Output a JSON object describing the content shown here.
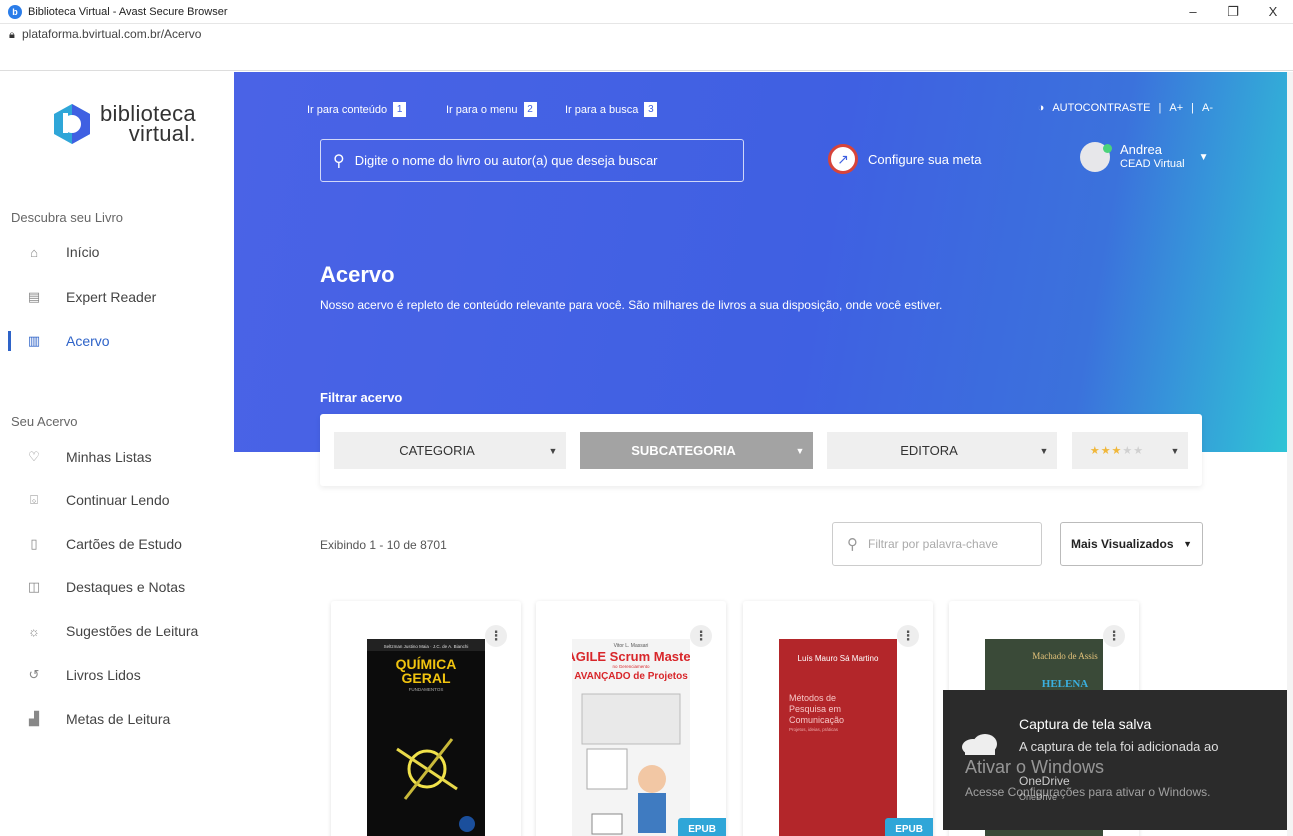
{
  "browser": {
    "window_title": "Biblioteca Virtual - Avast Secure Browser",
    "url": "plataforma.bvirtual.com.br/Acervo",
    "controls": {
      "minimize": "–",
      "restore": "❐",
      "close": "X"
    }
  },
  "logo": {
    "line1": "biblioteca",
    "line2": "virtual."
  },
  "sidebar": {
    "section1": "Descubra seu Livro",
    "items1": [
      {
        "label": "Início",
        "icon": "home-icon"
      },
      {
        "label": "Expert Reader",
        "icon": "reader-icon"
      },
      {
        "label": "Acervo",
        "icon": "books-icon",
        "active": true
      }
    ],
    "section2": "Seu Acervo",
    "items2": [
      {
        "label": "Minhas Listas",
        "icon": "heart-icon"
      },
      {
        "label": "Continuar Lendo",
        "icon": "bookmark-icon"
      },
      {
        "label": "Cartões de Estudo",
        "icon": "cards-icon"
      },
      {
        "label": "Destaques e Notas",
        "icon": "note-icon"
      },
      {
        "label": "Sugestões de Leitura",
        "icon": "bulb-icon"
      },
      {
        "label": "Livros Lidos",
        "icon": "history-icon"
      },
      {
        "label": "Metas de Leitura",
        "icon": "goals-icon"
      }
    ]
  },
  "header": {
    "skip_links": [
      {
        "label": "Ir para conteúdo",
        "key": "1"
      },
      {
        "label": "Ir para o menu",
        "key": "2"
      },
      {
        "label": "Ir para a busca",
        "key": "3"
      }
    ],
    "autocontrast": "AUTOCONTRASTE",
    "font_up": "A+",
    "font_down": "A-",
    "search_placeholder": "Digite o nome do livro ou autor(a) que deseja buscar",
    "goal_label": "Configure sua meta",
    "user_name": "Andrea",
    "user_org": "CEAD Virtual"
  },
  "hero": {
    "title": "Acervo",
    "subtitle": "Nosso acervo é repleto de conteúdo relevante para você. São milhares de livros a sua disposição, onde você estiver.",
    "filter_label": "Filtrar acervo"
  },
  "filters": {
    "category": "CATEGORIA",
    "subcategory": "SUBCATEGORIA",
    "publisher": "EDITORA",
    "rating_stars": 3
  },
  "results": {
    "count_text": "Exibindo 1 - 10 de 8701",
    "keyword_placeholder": "Filtrar por palavra-chave",
    "sort_label": "Mais Visualizados"
  },
  "books": [
    {
      "title": "QUÍMICA GERAL",
      "authors": "Seltzman Justino Maia · J.C. de A. Bianchi",
      "subtitle": "FUNDAMENTOS",
      "epub": false,
      "cover_color": "#0c0c0c"
    },
    {
      "title": "AGILE Scrum Master",
      "line2": "AVANÇADO de Projetos",
      "author": "Vitor L. Massari",
      "small": "no Gerenciamento",
      "epub": true,
      "epub_label": "EPUB",
      "cover_color": "#f4f4f4"
    },
    {
      "title": "Métodos de Pesquisa em Comunicação",
      "author": "Luís Mauro Sá Martino",
      "small": "Projetos, ideias, práticas",
      "epub": true,
      "epub_label": "EPUB",
      "cover_color": "#b3262a"
    },
    {
      "title": "HELENA",
      "author": "Machado de Assis",
      "epub": false,
      "cover_color": "#3a4a38"
    }
  ],
  "toast": {
    "title": "Captura de tela salva",
    "body": "A captura de tela foi adicionada ao",
    "app": "OneDrive",
    "app_small": "OneDrive"
  },
  "watermark": {
    "line1": "Ativar o Windows",
    "line2": "Acesse Configurações para ativar o Windows."
  }
}
